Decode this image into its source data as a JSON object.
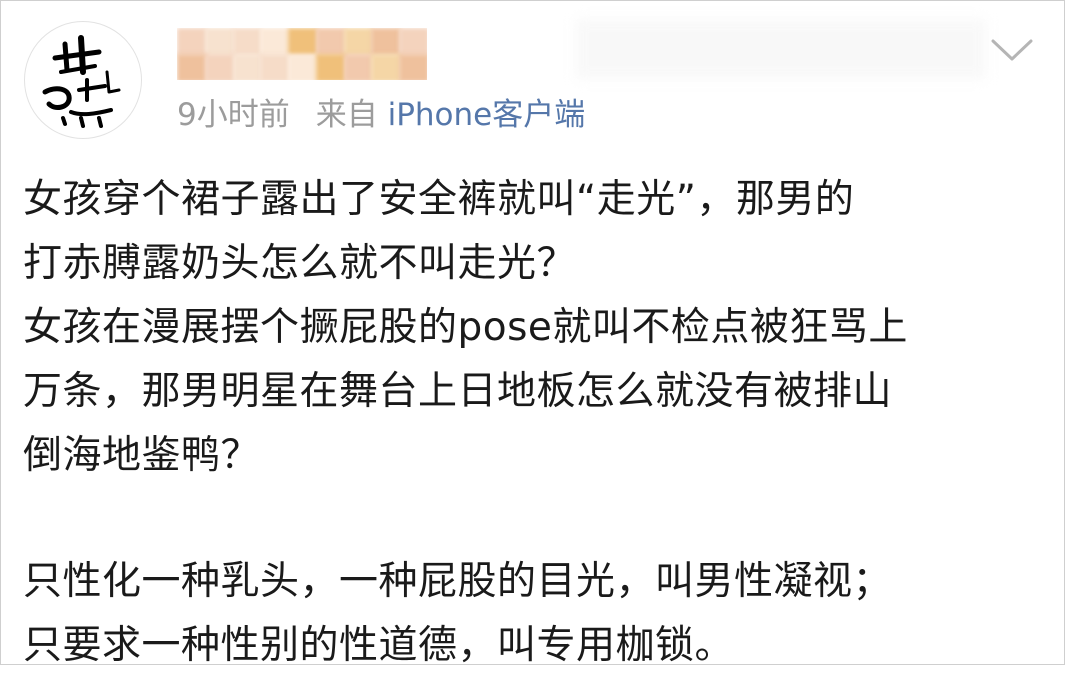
{
  "post": {
    "author_name": "",
    "time_ago": "9小时前",
    "source_prefix": "来自",
    "source": "iPhone客户端",
    "paragraph1": [
      "女孩穿个裙子露出了安全裤就叫“走光”，那男的",
      "打赤膊露奶头怎么就不叫走光？",
      "女孩在漫展摆个撅屁股的pose就叫不检点被狂骂上",
      "万条，那男明星在舞台上日地板怎么就没有被排山",
      "倒海地鉴鸭？"
    ],
    "paragraph2": [
      "只性化一种乳头，一种屁股的目光，叫男性凝视；",
      "只要求一种性别的性道德，叫专用枷锁。"
    ]
  },
  "icons": {
    "avatar": "calligraphy-avatar",
    "menu": "chevron-down-icon"
  },
  "colors": {
    "meta_text": "#9c9c9c",
    "source_link": "#5577aa",
    "body_text": "#1a1a1a"
  }
}
